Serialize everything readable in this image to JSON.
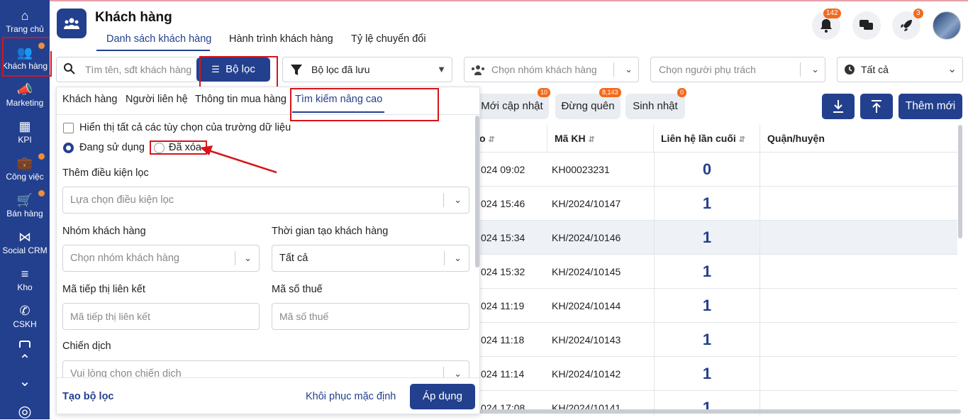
{
  "sidebar": {
    "items": [
      {
        "label": "Trang chủ",
        "icon": "home-icon",
        "glyph": "⌂"
      },
      {
        "label": "Khách hàng",
        "icon": "people-icon",
        "glyph": "👥"
      },
      {
        "label": "Marketing",
        "icon": "megaphone-icon",
        "glyph": "📣"
      },
      {
        "label": "KPI",
        "icon": "chart-icon",
        "glyph": "▦"
      },
      {
        "label": "Công việc",
        "icon": "briefcase-icon",
        "glyph": "💼"
      },
      {
        "label": "Bán hàng",
        "icon": "cart-icon",
        "glyph": "🛒"
      },
      {
        "label": "Social CRM",
        "icon": "share-icon",
        "glyph": "⋈"
      },
      {
        "label": "Kho",
        "icon": "warehouse-icon",
        "glyph": "≡"
      },
      {
        "label": "CSKH",
        "icon": "phone-icon",
        "glyph": "✆"
      }
    ],
    "scroll_up": "⌃",
    "scroll_down": "⌄",
    "support": "◎"
  },
  "header": {
    "title": "Khách hàng",
    "tabs": [
      "Danh sách khách hàng",
      "Hành trình khách hàng",
      "Tỷ lệ chuyển đổi"
    ],
    "notification_count": "142",
    "rocket_count": "3"
  },
  "filters": {
    "search_placeholder": "Tìm tên, sđt khách hàng",
    "filter_button": "Bộ lọc",
    "saved_filter": "Bộ lọc đã lưu",
    "group_placeholder": "Chọn nhóm khách hàng",
    "owner_placeholder": "Chọn người phụ trách",
    "time_value": "Tất cả"
  },
  "pills": [
    {
      "label": "Mới cập nhật",
      "count": "10"
    },
    {
      "label": "Đừng quên",
      "count": "8,143"
    },
    {
      "label": "Sinh nhật",
      "count": "0"
    }
  ],
  "actions": {
    "add_new": "Thêm mới"
  },
  "table": {
    "headers": [
      "o",
      "Mã KH",
      "Liên hệ lần cuối",
      "Quận/huyện"
    ],
    "rows": [
      {
        "date": "024 09:02",
        "code": "KH00023231",
        "contacts": "0"
      },
      {
        "date": "024 15:46",
        "code": "KH/2024/10147",
        "contacts": "1"
      },
      {
        "date": "024 15:34",
        "code": "KH/2024/10146",
        "contacts": "1"
      },
      {
        "date": "024 15:32",
        "code": "KH/2024/10145",
        "contacts": "1"
      },
      {
        "date": "024 11:19",
        "code": "KH/2024/10144",
        "contacts": "1"
      },
      {
        "date": "024 11:18",
        "code": "KH/2024/10143",
        "contacts": "1"
      },
      {
        "date": "024 11:14",
        "code": "KH/2024/10142",
        "contacts": "1"
      },
      {
        "date": "024 17:08",
        "code": "KH/2024/10141",
        "contacts": "1"
      }
    ]
  },
  "panel": {
    "tabs": [
      "Khách hàng",
      "Người liên hệ",
      "Thông tin mua hàng",
      "Tìm kiếm nâng cao"
    ],
    "show_all_options": "Hiển thị tất cả các tùy chọn của trường dữ liệu",
    "radio_in_use": "Đang sử dụng",
    "radio_deleted": "Đã xóa",
    "add_condition_label": "Thêm điều kiện lọc",
    "add_condition_placeholder": "Lựa chọn điều kiện lọc",
    "group_label": "Nhóm khách hàng",
    "group_placeholder": "Chọn nhóm khách hàng",
    "created_time_label": "Thời gian tạo khách hàng",
    "created_time_value": "Tất cả",
    "affiliate_label": "Mã tiếp thị liên kết",
    "affiliate_placeholder": "Mã tiếp thị liên kết",
    "tax_label": "Mã số thuế",
    "tax_placeholder": "Mã số thuế",
    "campaign_label": "Chiến dịch",
    "campaign_placeholder": "Vui lòng chọn chiến dịch",
    "create_filter": "Tạo bộ lọc",
    "restore_default": "Khôi phục mặc định",
    "apply": "Áp dụng"
  },
  "colors": {
    "primary": "#23408e",
    "badge": "#f26b1d",
    "highlight": "#d7141a"
  }
}
